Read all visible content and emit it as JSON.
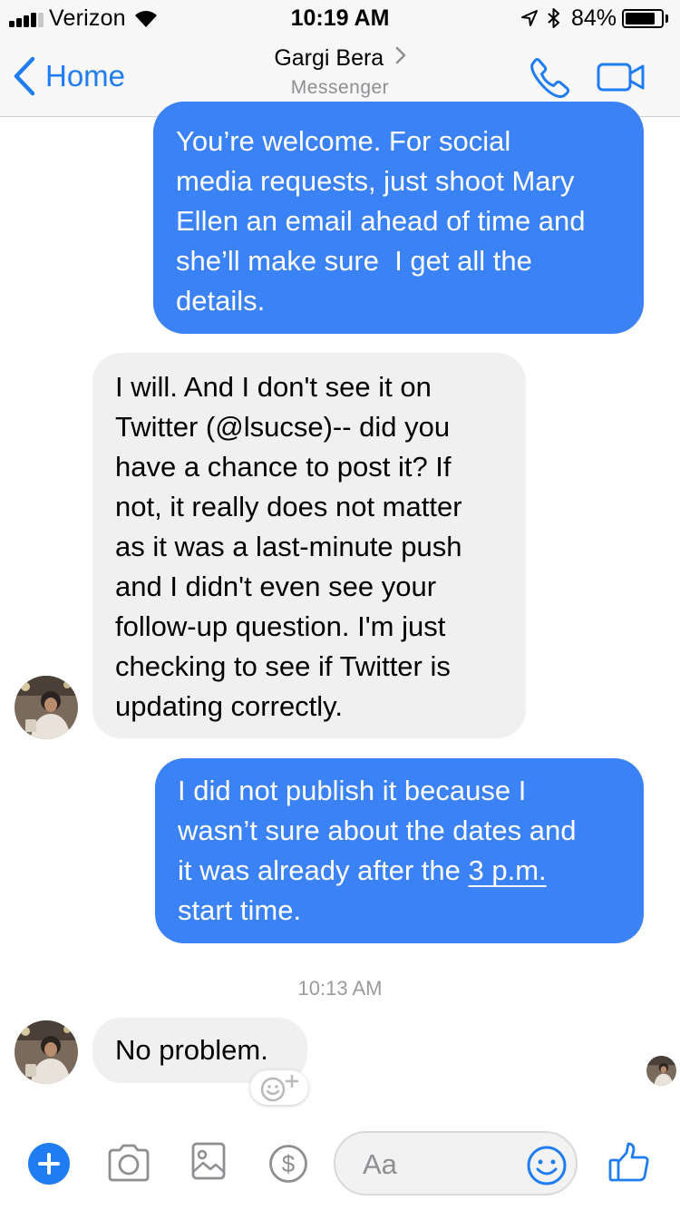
{
  "status_bar": {
    "carrier": "Verizon",
    "time": "10:19 AM",
    "battery_percent": "84%",
    "battery_level": 0.84,
    "signal_bars": 4,
    "icons": [
      "signal-icon",
      "wifi-icon",
      "location-arrow-icon",
      "bluetooth-icon",
      "battery-icon"
    ]
  },
  "nav": {
    "back_label": "Home",
    "contact_name": "Gargi Bera",
    "subtitle": "Messenger",
    "icons": [
      "back-chevron-icon",
      "chevron-right-icon",
      "phone-icon",
      "video-camera-icon"
    ]
  },
  "messages": [
    {
      "direction": "outgoing",
      "lines": [
        "You’re welcome. For social",
        "media requests, just shoot Mary",
        "Ellen an email ahead of time and",
        "she’ll make sure  I get all the",
        "details."
      ]
    },
    {
      "direction": "incoming",
      "lines": [
        "I will. And I don't see it on",
        "Twitter (@lsucse)-- did you",
        "have a chance to post it? If",
        "not, it really does not matter",
        "as it was a last-minute push",
        "and I didn't even see your",
        "follow-up question. I'm just",
        "checking to see if Twitter is",
        "updating correctly."
      ]
    },
    {
      "direction": "outgoing",
      "lines": [
        "I did not publish it because I",
        "wasn’t sure about the dates and"
      ],
      "line3_text": "it was already after the ",
      "line3_link": "3 p.m.",
      "line4": "start time."
    },
    {
      "direction": "incoming",
      "lines": [
        "No problem."
      ]
    }
  ],
  "timestamp": "10:13 AM",
  "composer": {
    "placeholder": "Aa",
    "accent_color": "#1f7cf2",
    "icons": [
      "plus-icon",
      "camera-icon",
      "gallery-icon",
      "payment-icon",
      "emoji-icon",
      "thumbs-up-icon",
      "add-reaction-icon"
    ]
  }
}
